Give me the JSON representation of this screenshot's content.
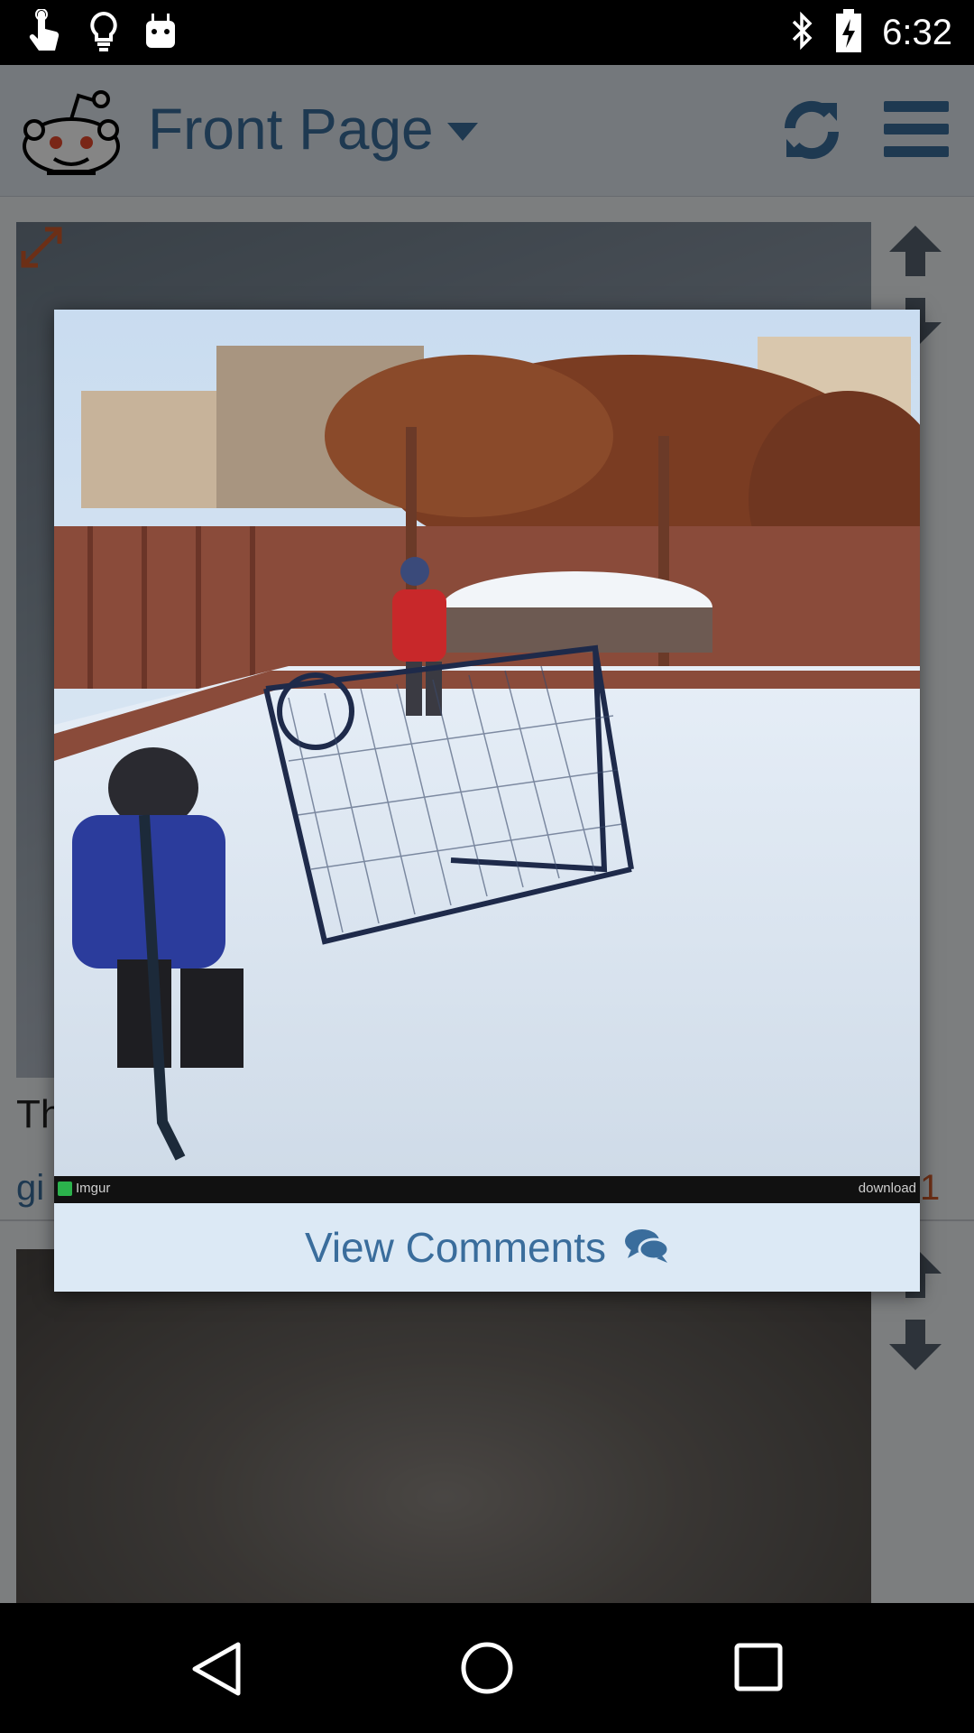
{
  "status_bar": {
    "time": "6:32",
    "left_icons": [
      "touch-icon",
      "lightbulb-icon",
      "android-icon"
    ],
    "right_icons": [
      "bluetooth-icon",
      "battery-charging-icon"
    ]
  },
  "app_bar": {
    "title": "Front Page",
    "icons": [
      "reddit-alien-logo-icon",
      "refresh-icon",
      "menu-icon"
    ],
    "accent_color": "#3a6d9c"
  },
  "feed": {
    "post_1": {
      "title_partial": "Th",
      "meta_partial": "gi",
      "score_partial": "1"
    }
  },
  "modal": {
    "source_label": "Imgur",
    "download_label": "download",
    "view_comments_label": "View Comments",
    "view_comments_icon": "comments-icon"
  },
  "nav_bar": {
    "icons": [
      "back-icon",
      "home-icon",
      "recents-icon"
    ]
  }
}
